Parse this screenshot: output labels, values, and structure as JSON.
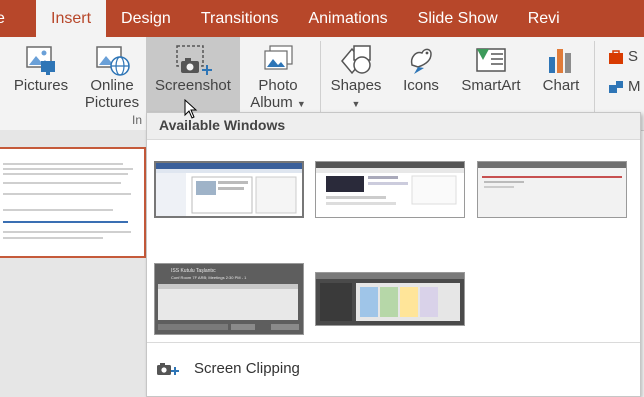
{
  "tabs": [
    {
      "label": "e",
      "active": false
    },
    {
      "label": "Insert",
      "active": true
    },
    {
      "label": "Design",
      "active": false
    },
    {
      "label": "Transitions",
      "active": false
    },
    {
      "label": "Animations",
      "active": false
    },
    {
      "label": "Slide Show",
      "active": false
    },
    {
      "label": "Revi",
      "active": false
    }
  ],
  "ribbon": {
    "pictures": "Pictures",
    "online_pictures_1": "Online",
    "online_pictures_2": "Pictures",
    "screenshot": "Screenshot",
    "photo_album_1": "Photo",
    "photo_album_2": "Album",
    "shapes": "Shapes",
    "icons": "Icons",
    "smartart": "SmartArt",
    "chart": "Chart",
    "group_label": "In",
    "cut_letter_1": "S",
    "cut_letter_2": "M"
  },
  "dropdown": {
    "header": "Available Windows",
    "windows": [
      {
        "name": "window-thumbnail-1"
      },
      {
        "name": "window-thumbnail-2"
      },
      {
        "name": "window-thumbnail-3"
      },
      {
        "name": "window-thumbnail-4"
      },
      {
        "name": "window-thumbnail-5"
      }
    ],
    "window4_title": "ISS Kutulu Taşlantıc",
    "window4_sub": "Conf Room 7F ARB; Meetings 2:30 PM - 1",
    "clipping_label": "Screen Clipping",
    "clipping_underline": "C"
  },
  "colors": {
    "accent": "#b7472a",
    "ribbon_bg": "#f3f3f3"
  }
}
